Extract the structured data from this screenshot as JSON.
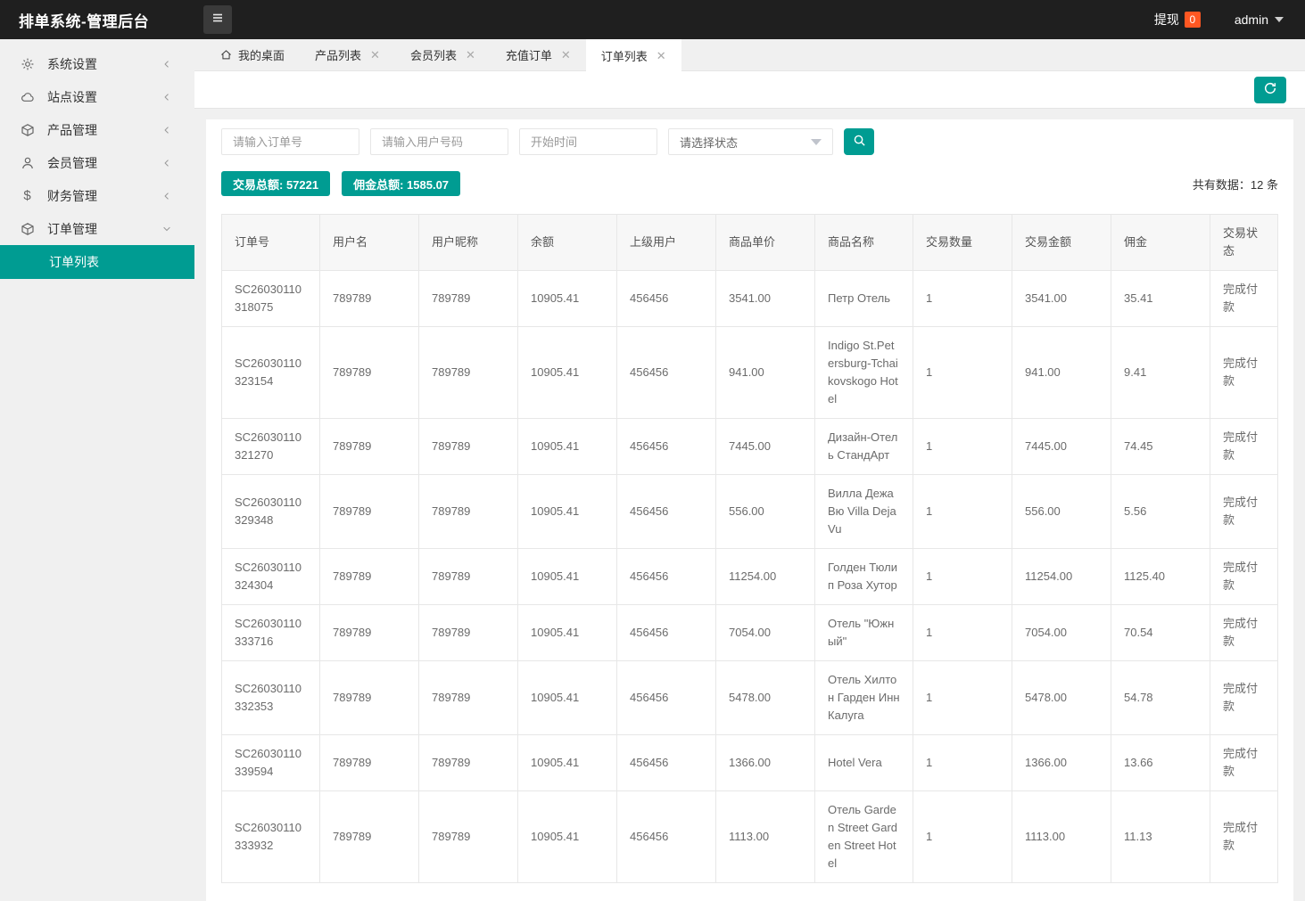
{
  "topbar": {
    "title": "排单系统-管理后台",
    "withdraw_label": "提现",
    "withdraw_badge": "0",
    "username": "admin"
  },
  "sidebar": {
    "items": [
      {
        "label": "系统设置",
        "icon": "gear-icon",
        "state": "collapsed"
      },
      {
        "label": "站点设置",
        "icon": "cloud-icon",
        "state": "collapsed"
      },
      {
        "label": "产品管理",
        "icon": "cube-icon",
        "state": "collapsed"
      },
      {
        "label": "会员管理",
        "icon": "user-icon",
        "state": "collapsed"
      },
      {
        "label": "财务管理",
        "icon": "dollar-icon",
        "state": "collapsed"
      },
      {
        "label": "订单管理",
        "icon": "cube-icon",
        "state": "expanded"
      }
    ],
    "active_submenu": "订单列表"
  },
  "tabs": [
    {
      "label": "我的桌面",
      "closable": false,
      "active": false
    },
    {
      "label": "产品列表",
      "closable": true,
      "active": false
    },
    {
      "label": "会员列表",
      "closable": true,
      "active": false
    },
    {
      "label": "充值订单",
      "closable": true,
      "active": false
    },
    {
      "label": "订单列表",
      "closable": true,
      "active": true
    }
  ],
  "filters": {
    "order_placeholder": "请输入订单号",
    "user_placeholder": "请输入用户号码",
    "time_placeholder": "开始时间",
    "status_value": "请选择状态"
  },
  "summary": {
    "trade_total": "交易总额: 57221",
    "commission_total": "佣金总额: 1585.07",
    "record_count": "共有数据：12 条"
  },
  "table": {
    "headers": [
      "订单号",
      "用户名",
      "用户昵称",
      "余额",
      "上级用户",
      "商品单价",
      "商品名称",
      "交易数量",
      "交易金额",
      "佣金",
      "交易状态"
    ],
    "rows": [
      {
        "order_no": "SC26030110318075",
        "username": "789789",
        "nickname": "789789",
        "balance": "10905.41",
        "parent": "456456",
        "unit_price": "3541.00",
        "product": "Петр Отель",
        "qty": "1",
        "amount": "3541.00",
        "commission": "35.41",
        "status": "完成付款"
      },
      {
        "order_no": "SC26030110323154",
        "username": "789789",
        "nickname": "789789",
        "balance": "10905.41",
        "parent": "456456",
        "unit_price": "941.00",
        "product": "Indigo St.Petersburg-Tchaikovskogo Hotel",
        "qty": "1",
        "amount": "941.00",
        "commission": "9.41",
        "status": "完成付款"
      },
      {
        "order_no": "SC26030110321270",
        "username": "789789",
        "nickname": "789789",
        "balance": "10905.41",
        "parent": "456456",
        "unit_price": "7445.00",
        "product": "Дизайн-Отель СтандАрт",
        "qty": "1",
        "amount": "7445.00",
        "commission": "74.45",
        "status": "完成付款"
      },
      {
        "order_no": "SC26030110329348",
        "username": "789789",
        "nickname": "789789",
        "balance": "10905.41",
        "parent": "456456",
        "unit_price": "556.00",
        "product": "Вилла Дежа Вю Villa Deja Vu",
        "qty": "1",
        "amount": "556.00",
        "commission": "5.56",
        "status": "完成付款"
      },
      {
        "order_no": "SC26030110324304",
        "username": "789789",
        "nickname": "789789",
        "balance": "10905.41",
        "parent": "456456",
        "unit_price": "11254.00",
        "product": "Голден Тюлип Роза Хутор",
        "qty": "1",
        "amount": "11254.00",
        "commission": "1125.40",
        "status": "完成付款"
      },
      {
        "order_no": "SC26030110333716",
        "username": "789789",
        "nickname": "789789",
        "balance": "10905.41",
        "parent": "456456",
        "unit_price": "7054.00",
        "product": "Отель \"Южный\"",
        "qty": "1",
        "amount": "7054.00",
        "commission": "70.54",
        "status": "完成付款"
      },
      {
        "order_no": "SC26030110332353",
        "username": "789789",
        "nickname": "789789",
        "balance": "10905.41",
        "parent": "456456",
        "unit_price": "5478.00",
        "product": "Отель Хилтон Гарден Инн Калуга",
        "qty": "1",
        "amount": "5478.00",
        "commission": "54.78",
        "status": "完成付款"
      },
      {
        "order_no": "SC26030110339594",
        "username": "789789",
        "nickname": "789789",
        "balance": "10905.41",
        "parent": "456456",
        "unit_price": "1366.00",
        "product": "Hotel Vera",
        "qty": "1",
        "amount": "1366.00",
        "commission": "13.66",
        "status": "完成付款"
      },
      {
        "order_no": "SC26030110333932",
        "username": "789789",
        "nickname": "789789",
        "balance": "10905.41",
        "parent": "456456",
        "unit_price": "1113.00",
        "product": "Отель Garden Street Garden Street Hotel",
        "qty": "1",
        "amount": "1113.00",
        "commission": "11.13",
        "status": "完成付款"
      }
    ]
  },
  "colors": {
    "accent_teal": "#009c92",
    "badge_orange": "#ff5722"
  }
}
